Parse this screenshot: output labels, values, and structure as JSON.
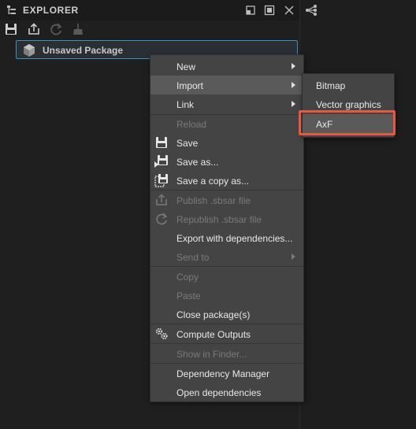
{
  "panel": {
    "title": "EXPLORER",
    "icons": [
      "tree-icon",
      "restore-icon",
      "maximize-icon",
      "close-icon"
    ]
  },
  "toolbar": {
    "icons": [
      "save-icon",
      "publish-icon",
      "republish-icon",
      "clean-icon"
    ]
  },
  "package": {
    "label": "Unsaved Package",
    "icon": "package-cube-icon"
  },
  "context_menu": {
    "items": [
      {
        "label": "New",
        "submenu": true,
        "enabled": true
      },
      {
        "label": "Import",
        "submenu": true,
        "enabled": true,
        "active": true
      },
      {
        "label": "Link",
        "submenu": true,
        "enabled": true
      },
      {
        "label": "Reload",
        "enabled": false
      },
      {
        "label": "Save",
        "enabled": true,
        "icon": "save-icon"
      },
      {
        "label": "Save as...",
        "enabled": true,
        "icon": "save-as-icon"
      },
      {
        "label": "Save a copy as...",
        "enabled": true,
        "icon": "save-copy-icon"
      },
      {
        "label": "Publish .sbsar file",
        "enabled": false,
        "icon": "publish-icon"
      },
      {
        "label": "Republish .sbsar file",
        "enabled": false,
        "icon": "republish-icon"
      },
      {
        "label": "Export with dependencies...",
        "enabled": true
      },
      {
        "label": "Send to",
        "submenu": true,
        "enabled": false
      },
      {
        "label": "Copy",
        "enabled": false
      },
      {
        "label": "Paste",
        "enabled": false
      },
      {
        "label": "Close package(s)",
        "enabled": true
      },
      {
        "label": "Compute Outputs",
        "enabled": true,
        "icon": "gears-icon"
      },
      {
        "label": "Show in Finder...",
        "enabled": false
      },
      {
        "label": "Dependency Manager",
        "enabled": true
      },
      {
        "label": "Open dependencies",
        "enabled": true
      }
    ]
  },
  "import_submenu": {
    "items": [
      {
        "label": "Bitmap"
      },
      {
        "label": "Vector graphics"
      },
      {
        "label": "AxF",
        "selected": true
      }
    ]
  },
  "colors": {
    "highlight": "#e9573f",
    "selection_border": "#3a8fc4",
    "menu_bg": "#444444"
  }
}
